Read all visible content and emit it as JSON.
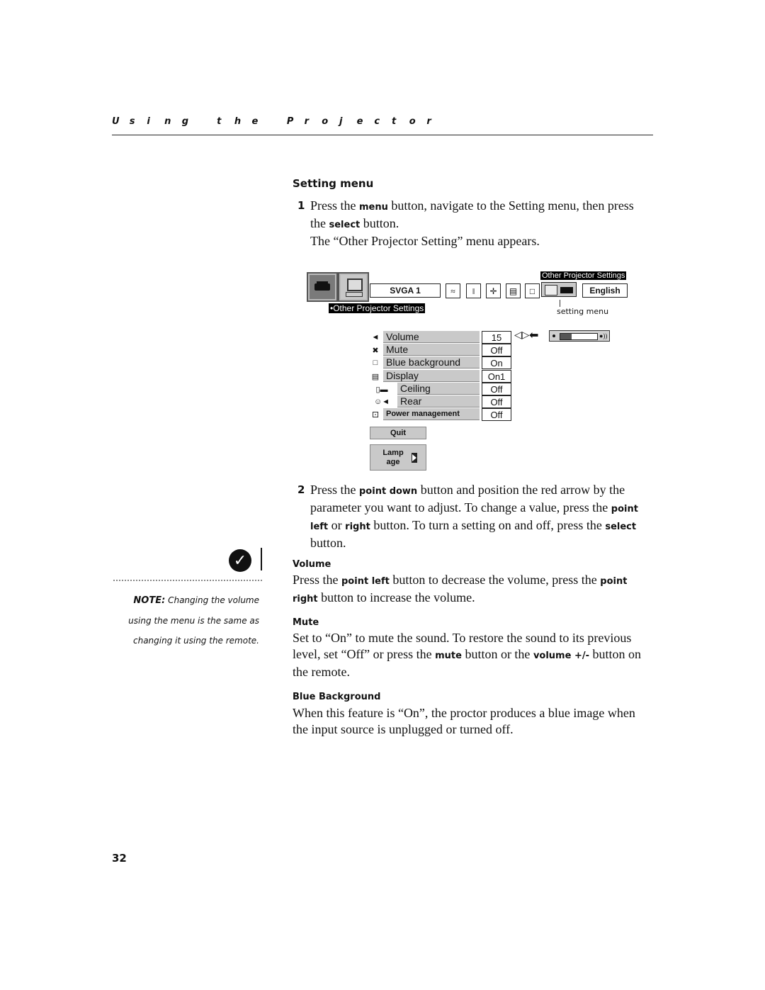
{
  "running_header": "Using the Projector",
  "section_title": "Setting menu",
  "steps": [
    {
      "number": "1",
      "parts": [
        {
          "t": "Press the ",
          "b": false
        },
        {
          "t": "menu",
          "b": true
        },
        {
          "t": " button, navigate to the Setting menu, then press the ",
          "b": false
        },
        {
          "t": "select",
          "b": true
        },
        {
          "t": " button.",
          "b": false
        }
      ],
      "followup": "The “Other Projector Setting” menu appears."
    },
    {
      "number": "2",
      "parts": [
        {
          "t": "Press the ",
          "b": false
        },
        {
          "t": "point down",
          "b": true
        },
        {
          "t": " button and position the red arrow by the parameter you want to adjust. To change a value, press the ",
          "b": false
        },
        {
          "t": "point left",
          "b": true
        },
        {
          "t": " or ",
          "b": false
        },
        {
          "t": "right",
          "b": true
        },
        {
          "t": " button. To turn a setting on and off, press the ",
          "b": false
        },
        {
          "t": "select",
          "b": true
        },
        {
          "t": " button.",
          "b": false
        }
      ]
    }
  ],
  "osd": {
    "source_field": "SVGA 1",
    "language_field": "English",
    "top_right_title": "Other Projector Settings",
    "menu_title": "•Other Projector Settings",
    "callout_label": "setting menu",
    "toolbar_icons": [
      "image-adjust-icon",
      "sound-icon",
      "screen-position-icon",
      "screen-icon",
      "keystone-icon",
      "setting-menu-icon"
    ],
    "rows": [
      {
        "icon": "volume-icon",
        "glyph": "◄",
        "label": "Volume",
        "value": "15"
      },
      {
        "icon": "mute-icon",
        "glyph": "✖",
        "label": "Mute",
        "value": "Off"
      },
      {
        "icon": "blue-background-icon",
        "glyph": "□",
        "label": "Blue background",
        "value": "On"
      },
      {
        "icon": "display-icon",
        "glyph": "▤",
        "label": "Display",
        "value": "On1"
      },
      {
        "icon": "ceiling-icon",
        "glyph": "▯▬",
        "label": "Ceiling",
        "value": "Off"
      },
      {
        "icon": "rear-icon",
        "glyph": "☺◄",
        "label": "Rear",
        "value": "Off"
      },
      {
        "icon": "power-management-icon",
        "glyph": "⚀",
        "label": "Power management",
        "value": "Off"
      }
    ],
    "volume_level": 0.3,
    "quit_label": "Quit",
    "lamp_age_label": "Lamp age"
  },
  "sections": [
    {
      "heading": "Volume",
      "parts": [
        {
          "t": "Press the ",
          "b": false
        },
        {
          "t": "point left",
          "b": true
        },
        {
          "t": " button to decrease the volume, press the ",
          "b": false
        },
        {
          "t": "point right",
          "b": true
        },
        {
          "t": " button to increase the volume.",
          "b": false
        }
      ]
    },
    {
      "heading": "Mute",
      "parts": [
        {
          "t": "Set to “On” to mute the sound. To restore the sound to its previous level, set “Off” or press the ",
          "b": false
        },
        {
          "t": "mute",
          "b": true
        },
        {
          "t": " button or the ",
          "b": false
        },
        {
          "t": "volume +/-",
          "b": true
        },
        {
          "t": " button on the remote.",
          "b": false
        }
      ]
    },
    {
      "heading": "Blue Background",
      "parts": [
        {
          "t": "When this feature is “On”, the proctor produces a blue image when the input source is unplugged or turned off.",
          "b": false
        }
      ]
    }
  ],
  "note": {
    "label": "NOTE:",
    "text": " Changing the volume using the menu is the same as changing it using the remote."
  },
  "page_number": "32"
}
